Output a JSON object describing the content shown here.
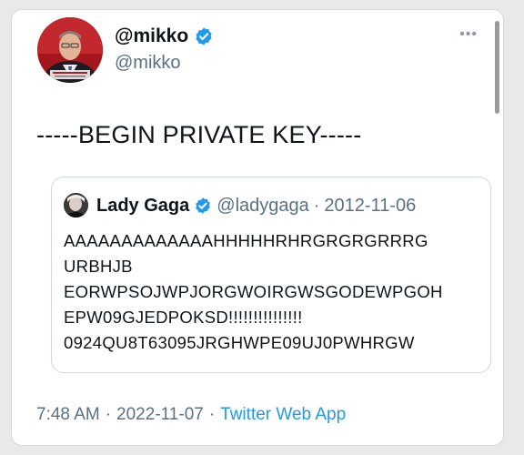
{
  "author": {
    "display_name": "@mikko",
    "handle": "@mikko",
    "verified": true,
    "avatar_icon": "profile-photo"
  },
  "tweet": {
    "text": "-----BEGIN PRIVATE KEY-----",
    "time": "7:48 AM",
    "separator": "·",
    "date": "2022-11-07",
    "source": "Twitter Web App"
  },
  "quoted": {
    "display_name": "Lady Gaga",
    "verified": true,
    "handle": "@ladygaga",
    "separator": "·",
    "date": "2012-11-06",
    "lines": [
      "AAAAAAAAAAAAAHHHHHRHRGRGRGRRRG",
      "URBHJB",
      "EORWPSOJWPJORGWOIRGWSGODEWPGOH",
      "EPW09GJEDPOKSD!!!!!!!!!!!!!!!",
      "0924QU8T63095JRGHWPE09UJ0PWHRGW"
    ]
  },
  "colors": {
    "verified_badge": "#1d9bf0",
    "link": "#1d9bf0",
    "secondary_text": "#5b7083"
  }
}
